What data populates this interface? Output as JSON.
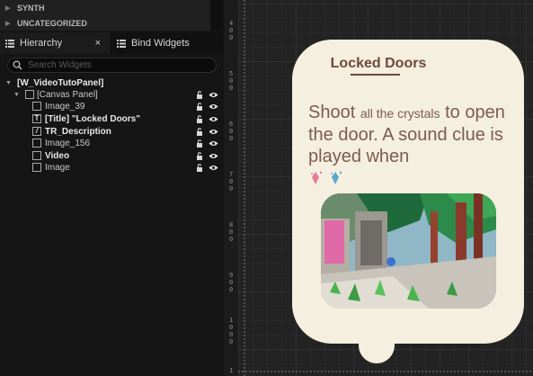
{
  "left_panel": {
    "categories": [
      {
        "label": "SYNTH"
      },
      {
        "label": "UNCATEGORIZED"
      }
    ],
    "tabs": {
      "hierarchy": {
        "label": "Hierarchy",
        "close": "×"
      },
      "bind_widgets": {
        "label": "Bind Widgets"
      }
    },
    "search": {
      "placeholder": "Search Widgets",
      "value": ""
    },
    "tree": {
      "root": "[W_VideoTutoPanel]",
      "canvas_panel": "[Canvas Panel]",
      "image_39": "Image_39",
      "title_item": "[Title] \"Locked Doors\"",
      "tr_description": "TR_Description",
      "image_156": "Image_156",
      "video": "Video",
      "image": "Image"
    }
  },
  "designer": {
    "ruler_labels": [
      "4",
      "0",
      "0",
      "5",
      "0",
      "0",
      "6",
      "0",
      "0",
      "7",
      "0",
      "0",
      "8",
      "0",
      "0",
      "9",
      "0",
      "0",
      "1",
      "0",
      "0",
      "0",
      "1"
    ],
    "panel": {
      "title": "Locked Doors",
      "desc_part1": "Shoot",
      "desc_part2": "all the crystals",
      "desc_part3": "to open the door. A sound clue is played when"
    },
    "colors": {
      "panel_bg": "#f4efdf",
      "title_color": "#6e4a3b",
      "desc_color": "#7d5c50"
    }
  }
}
